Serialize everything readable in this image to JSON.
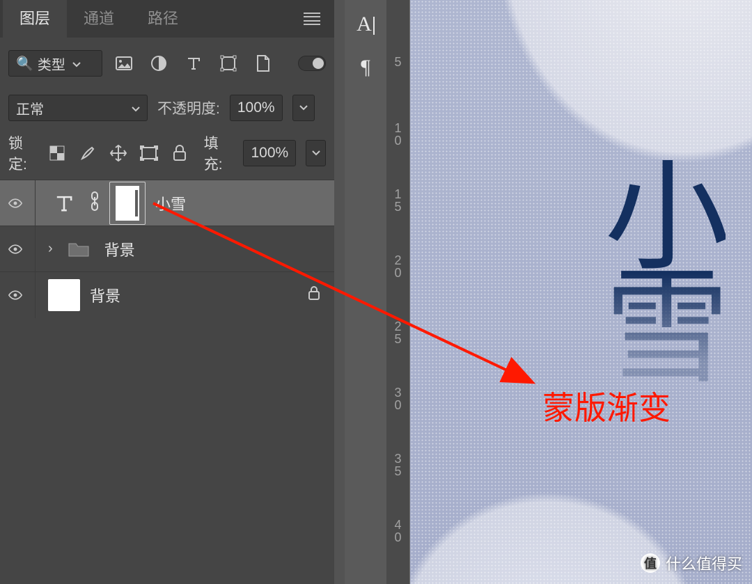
{
  "tabs": {
    "layers": "图层",
    "channels": "通道",
    "paths": "路径"
  },
  "filter": {
    "type_label": "类型",
    "search_icon": "🔍"
  },
  "blend": {
    "mode": "正常",
    "opacity_label": "不透明度:",
    "opacity_value": "100%"
  },
  "lock": {
    "label": "锁定:",
    "fill_label": "填充:",
    "fill_value": "100%"
  },
  "layers": [
    {
      "name": "小雪",
      "type": "text",
      "linked": true,
      "masked": true
    },
    {
      "name": "背景",
      "type": "group"
    },
    {
      "name": "背景",
      "type": "bg",
      "locked": true
    }
  ],
  "ruler_ticks": [
    "5",
    "1\n0",
    "1\n5",
    "2\n0",
    "2\n5",
    "3\n0",
    "3\n5",
    "4\n0"
  ],
  "canvas_text": {
    "char1": "小",
    "char2": "雪"
  },
  "annotation": "蒙版渐变",
  "tool_glyphs": {
    "text_cursor": "A",
    "pilcrow": "¶"
  },
  "watermark": {
    "glyph": "值",
    "text": "什么值得买"
  }
}
